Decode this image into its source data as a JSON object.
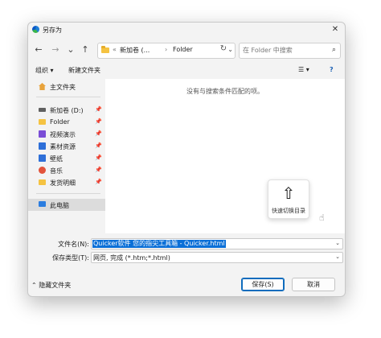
{
  "titlebar": {
    "title": "另存为",
    "close": "✕"
  },
  "nav": {
    "back": "←",
    "forward": "→",
    "recent": "⌄",
    "up": "↑",
    "address": {
      "prefix": "«",
      "segment1": "新加卷 (...",
      "sep": "›",
      "segment2": "Folder",
      "dropdown": "⌄"
    },
    "refresh": "↻",
    "search_placeholder": "在 Folder 中搜索",
    "search_icon": "⌕"
  },
  "toolbar": {
    "organize": "组织 ▾",
    "new_folder": "新建文件夹",
    "view": "☰ ▾",
    "help": "?"
  },
  "sidebar": {
    "items": [
      {
        "label": "主文件夹",
        "icon": "home-icon",
        "color": "#e8a33b"
      },
      {
        "label": "新加卷 (D:)",
        "icon": "drive-icon",
        "color": "#606060",
        "pin": "📌"
      },
      {
        "label": "Folder",
        "icon": "folder-icon",
        "color": "#f5c342",
        "pin": "📌"
      },
      {
        "label": "视频演示",
        "icon": "video-folder-icon",
        "color": "#7a4dd6",
        "pin": "📌"
      },
      {
        "label": "素材资源",
        "icon": "image-folder-icon",
        "color": "#2e6fd8",
        "pin": "📌"
      },
      {
        "label": "壁纸",
        "icon": "wallpaper-icon",
        "color": "#2e6fd8",
        "pin": "📌"
      },
      {
        "label": "音乐",
        "icon": "music-icon",
        "color": "#e2533b",
        "pin": "📌"
      },
      {
        "label": "发货明细",
        "icon": "file-folder-icon",
        "color": "#f5c342",
        "pin": "📌"
      },
      {
        "label": "此电脑",
        "icon": "pc-icon",
        "color": "#2b7de0"
      }
    ]
  },
  "content": {
    "empty_message": "没有与搜索条件匹配的项。",
    "quick_switch_label": "快速切换目录",
    "quick_switch_arrow": "⇧",
    "cursor": "☝"
  },
  "fields": {
    "filename_label": "文件名(N):",
    "filename_value": "Quicker软件 您的指尖工具箱 - Quicker.html",
    "filetype_label": "保存类型(T):",
    "filetype_value": "网页, 完成 (*.htm;*.html)",
    "dropdown": "⌄"
  },
  "footer": {
    "hide_folders": "⌃ 隐藏文件夹",
    "save": "保存(S)",
    "cancel": "取消"
  }
}
